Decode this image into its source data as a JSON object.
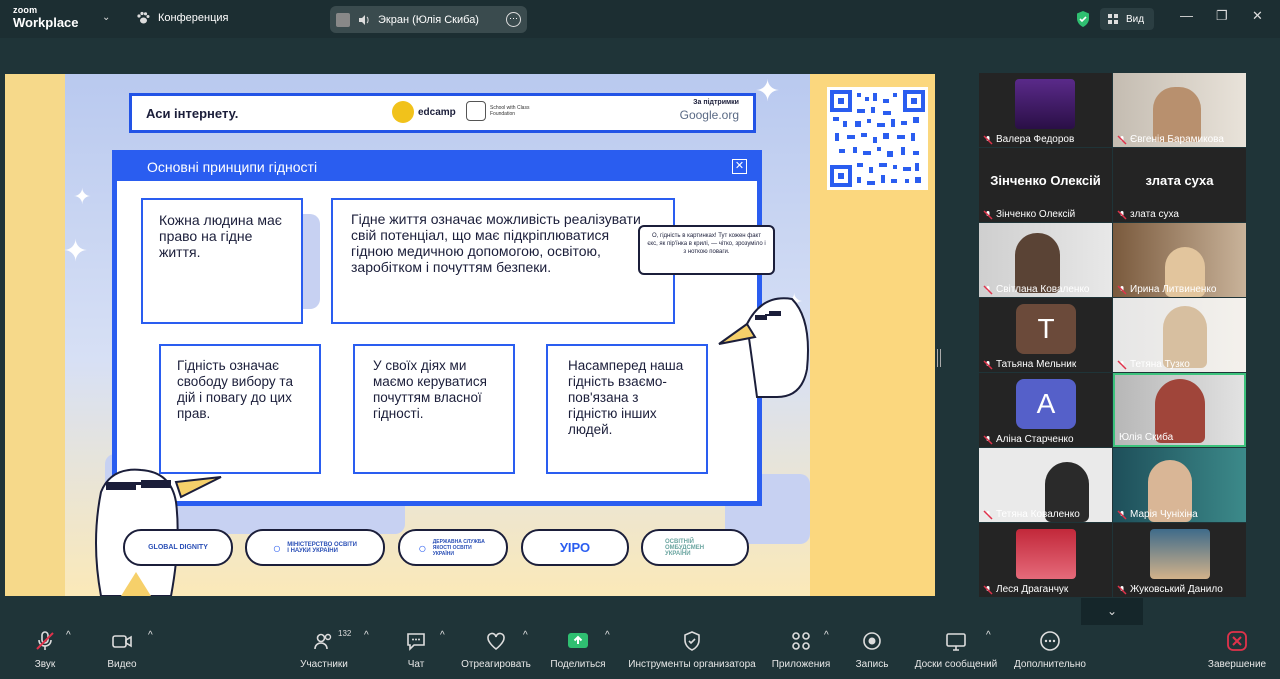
{
  "app": {
    "logo_top": "zoom",
    "logo_bottom": "Workplace",
    "meeting_label": "Конференция",
    "screen_share_label": "Экран (Юлія Скиба)",
    "view_label": "Вид"
  },
  "slide": {
    "header_title": "Аси інтернету.",
    "edcamp": "edcamp",
    "swc": "School with Class Foundation",
    "support_label": "За підтримки",
    "support_org": "Google.org",
    "window_title": "Основні принципи гідності",
    "box1": "Кожна людина має право на гідне життя.",
    "box2": "Гідне життя означає можливість реалізувати свій потенціал, що має підкріплюватися гідною медичною допомогою, освітою, заробітком і почуттям безпеки.",
    "box3": "Гідність означає свободу вибору та дій і повагу до цих прав.",
    "box4": "У своїх діях ми маємо керуватися почуттям власної гідності.",
    "box5": "Насамперед наша гідність взаємо-пов'язана з гідністю інших людей.",
    "bubble": "О, гідність в картинках! Тут кожен факт єкс, як пір'їнка в крилі, — чітко, зрозуміло і з ноткою поваги.",
    "logos": [
      "GLOBAL DIGNITY",
      "МІНІСТЕРСТВО ОСВІТИ І НАУКИ УКРАЇНИ",
      "ДЕРЖАВНА СЛУЖБА ЯКОСТІ ОСВІТИ УКРАЇНИ",
      "УІРО",
      "ОСВІТНІЙ ОМБУДСМЕН УКРАЇНИ"
    ]
  },
  "participants": [
    {
      "name": "Валера Федоров"
    },
    {
      "name": "Євгенія Барамикова"
    },
    {
      "name": "Зінченко Олексій",
      "big": "Зінченко Олексій"
    },
    {
      "name": "злата суха",
      "big": "злата суха"
    },
    {
      "name": "Світлана Коваленко"
    },
    {
      "name": "Ирина Литвиненко"
    },
    {
      "name": "Татьяна Мельник",
      "letter": "T"
    },
    {
      "name": "Тетяна Тузко"
    },
    {
      "name": "Аліна Старченко",
      "letter": "A"
    },
    {
      "name": "Юлія Скиба"
    },
    {
      "name": "Тетяна  Коваленко"
    },
    {
      "name": "Марія Чуніхіна"
    },
    {
      "name": "Леся Драганчук"
    },
    {
      "name": "Жуковський Данило"
    }
  ],
  "toolbar": {
    "audio": "Звук",
    "video": "Видео",
    "participants": "Участники",
    "participants_count": "132",
    "chat": "Чат",
    "react": "Отреагировать",
    "share": "Поделиться",
    "host_tools": "Инструменты организатора",
    "apps": "Приложения",
    "record": "Запись",
    "whiteboards": "Доски сообщений",
    "more": "Дополнительно",
    "end": "Завершение"
  },
  "colors": {
    "accent_blue": "#2a5df0",
    "zoom_green": "#3cc27c",
    "end_red": "#e0324b",
    "share_green": "#2fbf71"
  }
}
